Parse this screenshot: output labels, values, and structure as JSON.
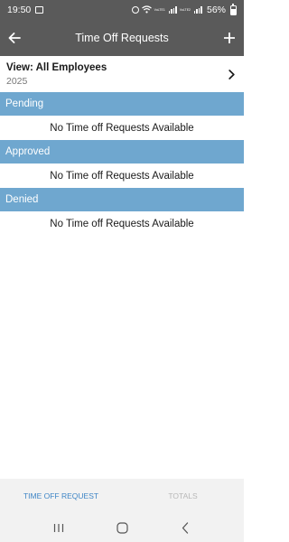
{
  "status_bar": {
    "time": "19:50",
    "battery_percent": "56%",
    "signal_label_1": "VoLTE1",
    "signal_label_2": "VoLTE2"
  },
  "app_bar": {
    "title": "Time Off Requests",
    "back_icon": "arrow-left-icon",
    "add_icon": "plus-icon"
  },
  "view_selector": {
    "label": "View: All Employees",
    "year": "2025",
    "icon": "chevron-right-icon"
  },
  "sections": [
    {
      "header": "Pending",
      "empty_message": "No Time off Requests Available"
    },
    {
      "header": "Approved",
      "empty_message": "No Time off Requests Available"
    },
    {
      "header": "Denied",
      "empty_message": "No Time off Requests Available"
    }
  ],
  "bottom_tabs": [
    {
      "label": "TIME OFF REQUEST",
      "active": true
    },
    {
      "label": "TOTALS",
      "active": false
    }
  ],
  "colors": {
    "app_bar": "#5a5a5a",
    "section_header": "#6fa7cf",
    "active_tab": "#3f86c6",
    "inactive_tab": "#b8b8b8"
  }
}
